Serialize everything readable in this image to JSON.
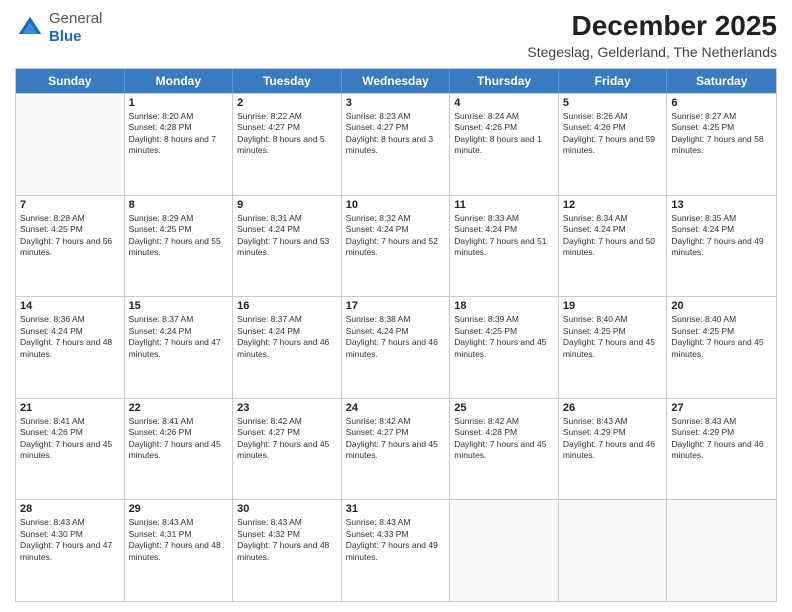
{
  "logo": {
    "general": "General",
    "blue": "Blue"
  },
  "header": {
    "month": "December 2025",
    "location": "Stegeslag, Gelderland, The Netherlands"
  },
  "days": [
    "Sunday",
    "Monday",
    "Tuesday",
    "Wednesday",
    "Thursday",
    "Friday",
    "Saturday"
  ],
  "weeks": [
    [
      {
        "date": "",
        "sunrise": "",
        "sunset": "",
        "daylight": "",
        "empty": true
      },
      {
        "date": "1",
        "sunrise": "Sunrise: 8:20 AM",
        "sunset": "Sunset: 4:28 PM",
        "daylight": "Daylight: 8 hours and 7 minutes."
      },
      {
        "date": "2",
        "sunrise": "Sunrise: 8:22 AM",
        "sunset": "Sunset: 4:27 PM",
        "daylight": "Daylight: 8 hours and 5 minutes."
      },
      {
        "date": "3",
        "sunrise": "Sunrise: 8:23 AM",
        "sunset": "Sunset: 4:27 PM",
        "daylight": "Daylight: 8 hours and 3 minutes."
      },
      {
        "date": "4",
        "sunrise": "Sunrise: 8:24 AM",
        "sunset": "Sunset: 4:26 PM",
        "daylight": "Daylight: 8 hours and 1 minute."
      },
      {
        "date": "5",
        "sunrise": "Sunrise: 8:26 AM",
        "sunset": "Sunset: 4:26 PM",
        "daylight": "Daylight: 7 hours and 59 minutes."
      },
      {
        "date": "6",
        "sunrise": "Sunrise: 8:27 AM",
        "sunset": "Sunset: 4:25 PM",
        "daylight": "Daylight: 7 hours and 58 minutes."
      }
    ],
    [
      {
        "date": "7",
        "sunrise": "Sunrise: 8:28 AM",
        "sunset": "Sunset: 4:25 PM",
        "daylight": "Daylight: 7 hours and 56 minutes."
      },
      {
        "date": "8",
        "sunrise": "Sunrise: 8:29 AM",
        "sunset": "Sunset: 4:25 PM",
        "daylight": "Daylight: 7 hours and 55 minutes."
      },
      {
        "date": "9",
        "sunrise": "Sunrise: 8:31 AM",
        "sunset": "Sunset: 4:24 PM",
        "daylight": "Daylight: 7 hours and 53 minutes."
      },
      {
        "date": "10",
        "sunrise": "Sunrise: 8:32 AM",
        "sunset": "Sunset: 4:24 PM",
        "daylight": "Daylight: 7 hours and 52 minutes."
      },
      {
        "date": "11",
        "sunrise": "Sunrise: 8:33 AM",
        "sunset": "Sunset: 4:24 PM",
        "daylight": "Daylight: 7 hours and 51 minutes."
      },
      {
        "date": "12",
        "sunrise": "Sunrise: 8:34 AM",
        "sunset": "Sunset: 4:24 PM",
        "daylight": "Daylight: 7 hours and 50 minutes."
      },
      {
        "date": "13",
        "sunrise": "Sunrise: 8:35 AM",
        "sunset": "Sunset: 4:24 PM",
        "daylight": "Daylight: 7 hours and 49 minutes."
      }
    ],
    [
      {
        "date": "14",
        "sunrise": "Sunrise: 8:36 AM",
        "sunset": "Sunset: 4:24 PM",
        "daylight": "Daylight: 7 hours and 48 minutes."
      },
      {
        "date": "15",
        "sunrise": "Sunrise: 8:37 AM",
        "sunset": "Sunset: 4:24 PM",
        "daylight": "Daylight: 7 hours and 47 minutes."
      },
      {
        "date": "16",
        "sunrise": "Sunrise: 8:37 AM",
        "sunset": "Sunset: 4:24 PM",
        "daylight": "Daylight: 7 hours and 46 minutes."
      },
      {
        "date": "17",
        "sunrise": "Sunrise: 8:38 AM",
        "sunset": "Sunset: 4:24 PM",
        "daylight": "Daylight: 7 hours and 46 minutes."
      },
      {
        "date": "18",
        "sunrise": "Sunrise: 8:39 AM",
        "sunset": "Sunset: 4:25 PM",
        "daylight": "Daylight: 7 hours and 45 minutes."
      },
      {
        "date": "19",
        "sunrise": "Sunrise: 8:40 AM",
        "sunset": "Sunset: 4:25 PM",
        "daylight": "Daylight: 7 hours and 45 minutes."
      },
      {
        "date": "20",
        "sunrise": "Sunrise: 8:40 AM",
        "sunset": "Sunset: 4:25 PM",
        "daylight": "Daylight: 7 hours and 45 minutes."
      }
    ],
    [
      {
        "date": "21",
        "sunrise": "Sunrise: 8:41 AM",
        "sunset": "Sunset: 4:26 PM",
        "daylight": "Daylight: 7 hours and 45 minutes."
      },
      {
        "date": "22",
        "sunrise": "Sunrise: 8:41 AM",
        "sunset": "Sunset: 4:26 PM",
        "daylight": "Daylight: 7 hours and 45 minutes."
      },
      {
        "date": "23",
        "sunrise": "Sunrise: 8:42 AM",
        "sunset": "Sunset: 4:27 PM",
        "daylight": "Daylight: 7 hours and 45 minutes."
      },
      {
        "date": "24",
        "sunrise": "Sunrise: 8:42 AM",
        "sunset": "Sunset: 4:27 PM",
        "daylight": "Daylight: 7 hours and 45 minutes."
      },
      {
        "date": "25",
        "sunrise": "Sunrise: 8:42 AM",
        "sunset": "Sunset: 4:28 PM",
        "daylight": "Daylight: 7 hours and 45 minutes."
      },
      {
        "date": "26",
        "sunrise": "Sunrise: 8:43 AM",
        "sunset": "Sunset: 4:29 PM",
        "daylight": "Daylight: 7 hours and 46 minutes."
      },
      {
        "date": "27",
        "sunrise": "Sunrise: 8:43 AM",
        "sunset": "Sunset: 4:29 PM",
        "daylight": "Daylight: 7 hours and 46 minutes."
      }
    ],
    [
      {
        "date": "28",
        "sunrise": "Sunrise: 8:43 AM",
        "sunset": "Sunset: 4:30 PM",
        "daylight": "Daylight: 7 hours and 47 minutes."
      },
      {
        "date": "29",
        "sunrise": "Sunrise: 8:43 AM",
        "sunset": "Sunset: 4:31 PM",
        "daylight": "Daylight: 7 hours and 48 minutes."
      },
      {
        "date": "30",
        "sunrise": "Sunrise: 8:43 AM",
        "sunset": "Sunset: 4:32 PM",
        "daylight": "Daylight: 7 hours and 48 minutes."
      },
      {
        "date": "31",
        "sunrise": "Sunrise: 8:43 AM",
        "sunset": "Sunset: 4:33 PM",
        "daylight": "Daylight: 7 hours and 49 minutes."
      },
      {
        "date": "",
        "sunrise": "",
        "sunset": "",
        "daylight": "",
        "empty": true
      },
      {
        "date": "",
        "sunrise": "",
        "sunset": "",
        "daylight": "",
        "empty": true
      },
      {
        "date": "",
        "sunrise": "",
        "sunset": "",
        "daylight": "",
        "empty": true
      }
    ]
  ]
}
